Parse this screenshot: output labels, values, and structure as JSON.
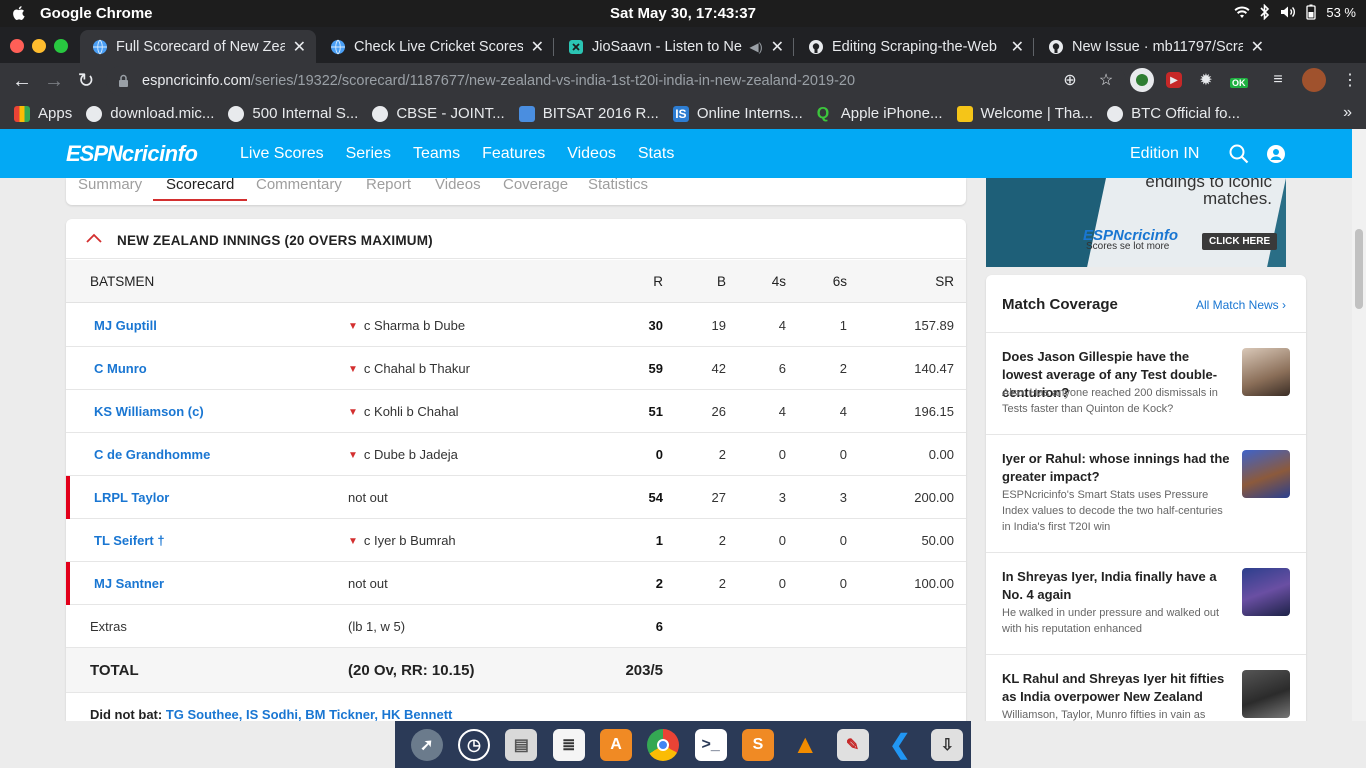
{
  "os": {
    "app_name": "Google Chrome",
    "clock": "Sat May 30, 17:43:37",
    "battery": "53 %"
  },
  "browser": {
    "tabs": [
      {
        "title": "Full Scorecard of New Zea",
        "active": true
      },
      {
        "title": "Check Live Cricket Scores,",
        "active": false
      },
      {
        "title": "JioSaavn - Listen to Ne",
        "active": false
      },
      {
        "title": "Editing Scraping-the-Web",
        "active": false
      },
      {
        "title": "New Issue · mb11797/Scra",
        "active": false
      }
    ],
    "url_host": "espncricinfo.com",
    "url_path": "/series/19322/scorecard/1187677/new-zealand-vs-india-1st-t20i-india-in-new-zealand-2019-20",
    "ext_badge": "OK",
    "bookmarks": [
      "Apps",
      "download.mic...",
      "500 Internal S...",
      "CBSE - JOINT...",
      "BITSAT 2016 R...",
      "Online Interns...",
      "Apple iPhone...",
      "Welcome | Tha...",
      "BTC Official fo..."
    ]
  },
  "site": {
    "logo_espn": "ESPN",
    "logo_cricinfo": "cricinfo",
    "nav": [
      "Live Scores",
      "Series",
      "Teams",
      "Features",
      "Videos",
      "Stats"
    ],
    "edition": "Edition IN",
    "subtabs": [
      "Summary",
      "Scorecard",
      "Commentary",
      "Report",
      "Videos",
      "Coverage",
      "Statistics"
    ]
  },
  "innings": {
    "title": "NEW ZEALAND INNINGS (20 OVERS MAXIMUM)",
    "headers": {
      "batsmen": "BATSMEN",
      "r": "R",
      "b": "B",
      "fours": "4s",
      "sixes": "6s",
      "sr": "SR"
    },
    "batsmen": [
      {
        "name": "MJ Guptill",
        "dismissal": "c Sharma b Dube",
        "r": "30",
        "b": "19",
        "fours": "4",
        "sixes": "1",
        "sr": "157.89",
        "out": true
      },
      {
        "name": "C Munro",
        "dismissal": "c Chahal b Thakur",
        "r": "59",
        "b": "42",
        "fours": "6",
        "sixes": "2",
        "sr": "140.47",
        "out": true
      },
      {
        "name": "KS Williamson (c)",
        "dismissal": "c Kohli b Chahal",
        "r": "51",
        "b": "26",
        "fours": "4",
        "sixes": "4",
        "sr": "196.15",
        "out": true
      },
      {
        "name": "C de Grandhomme",
        "dismissal": "c Dube b Jadeja",
        "r": "0",
        "b": "2",
        "fours": "0",
        "sixes": "0",
        "sr": "0.00",
        "out": true
      },
      {
        "name": "LRPL Taylor",
        "dismissal": "not out",
        "r": "54",
        "b": "27",
        "fours": "3",
        "sixes": "3",
        "sr": "200.00",
        "out": false
      },
      {
        "name": "TL Seifert †",
        "dismissal": "c Iyer b Bumrah",
        "r": "1",
        "b": "2",
        "fours": "0",
        "sixes": "0",
        "sr": "50.00",
        "out": true
      },
      {
        "name": "MJ Santner",
        "dismissal": "not out",
        "r": "2",
        "b": "2",
        "fours": "0",
        "sixes": "0",
        "sr": "100.00",
        "out": false
      }
    ],
    "extras": {
      "label": "Extras",
      "detail": "(lb 1, w 5)",
      "value": "6"
    },
    "total": {
      "label": "TOTAL",
      "detail": "(20 Ov, RR: 10.15)",
      "score": "203/5"
    },
    "did_not_bat": {
      "label": "Did not bat:",
      "players": "TG Southee, IS Sodhi, BM Tickner, HK Bennett"
    }
  },
  "ad": {
    "tagline": "endings to iconic matches.",
    "logo": "ESPNcricinfo",
    "sub": "Scores se lot more",
    "cta": "CLICK HERE"
  },
  "coverage": {
    "title": "Match Coverage",
    "all_link": "All Match News",
    "stories": [
      {
        "title": "Does Jason Gillespie have the lowest average of any Test double-centurion?",
        "desc": "Also: Has anyone reached 200 dismissals in Tests faster than Quinton de Kock?"
      },
      {
        "title": "Iyer or Rahul: whose innings had the greater impact?",
        "desc": "ESPNcricinfo's Smart Stats uses Pressure Index values to decode the two half-centuries in India's first T20I win"
      },
      {
        "title": "In Shreyas Iyer, India finally have a No. 4 again",
        "desc": "He walked in under pressure and walked out with his reputation enhanced"
      },
      {
        "title": "KL Rahul and Shreyas Iyer hit fifties as India overpower New Zealand",
        "desc": "Williamson, Taylor, Munro fifties in vain as India"
      }
    ]
  },
  "colors": {
    "espn_blue": "#03a9f4",
    "link_blue": "#1976d2",
    "not_out_red": "#e2001a",
    "chrome_dark": "#35363a"
  }
}
